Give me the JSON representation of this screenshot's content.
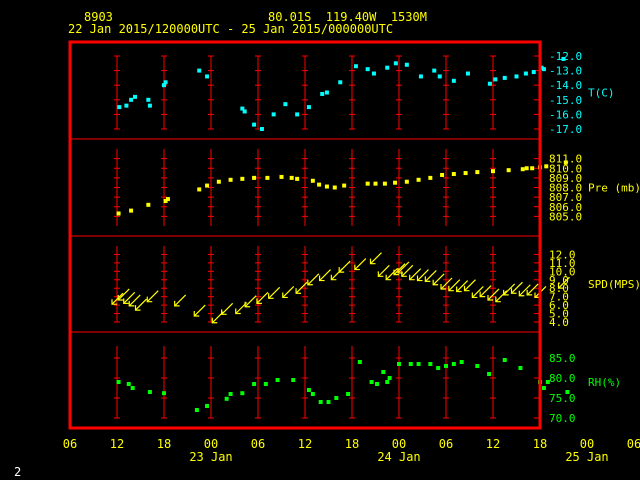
{
  "header": {
    "station_id": "8903",
    "location": "80.01S  119.40W  1530M",
    "time_range": "22 Jan 2015/120000UTC - 25 Jan 2015/000000UTC"
  },
  "page_number": "2",
  "colors": {
    "background": "#000000",
    "frame": "#ff0000",
    "grid": "#ff0000",
    "header_text": "#ffff00",
    "temperature": "#00ffff",
    "pressure": "#ffff00",
    "wind": "#ffff00",
    "humidity": "#00ff00"
  },
  "chart_data": {
    "type": "scatter",
    "grid": true,
    "x_axis": {
      "unit": "UTC hour",
      "range_hours": [
        -6,
        54
      ],
      "tick_labels": [
        "06",
        "12",
        "18",
        "00",
        "06",
        "12",
        "18",
        "00",
        "06",
        "12",
        "18",
        "00",
        "06"
      ],
      "tick_hours": [
        -6,
        0,
        6,
        12,
        18,
        24,
        30,
        36,
        42,
        48,
        54,
        60,
        66
      ],
      "day_labels": [
        {
          "label": "23 Jan",
          "hour": 12
        },
        {
          "label": "24 Jan",
          "hour": 36
        },
        {
          "label": "25 Jan",
          "hour": 60
        }
      ]
    },
    "panels": [
      {
        "key": "temperature",
        "label": "T(C)",
        "mark": "square",
        "ylim": [
          -17,
          -12
        ],
        "ticks": [
          -12.0,
          -13.0,
          -14.0,
          -15.0,
          -16.0,
          -17.0
        ],
        "tick_labels": [
          "-12.0",
          "-13.0",
          "-14.0",
          "-15.0",
          "-16.0",
          "-17.0"
        ],
        "points": [
          [
            0.3,
            -15.5
          ],
          [
            1.2,
            -15.4
          ],
          [
            1.8,
            -15.0
          ],
          [
            2.3,
            -14.8
          ],
          [
            4.0,
            -15.0
          ],
          [
            4.2,
            -15.4
          ],
          [
            6.0,
            -14.0
          ],
          [
            6.2,
            -13.8
          ],
          [
            10.5,
            -13.0
          ],
          [
            11.5,
            -13.4
          ],
          [
            16.0,
            -15.6
          ],
          [
            16.3,
            -15.8
          ],
          [
            17.5,
            -16.7
          ],
          [
            18.5,
            -17.0
          ],
          [
            20.0,
            -16.0
          ],
          [
            21.5,
            -15.3
          ],
          [
            23.0,
            -16.0
          ],
          [
            24.5,
            -15.5
          ],
          [
            26.2,
            -14.6
          ],
          [
            26.8,
            -14.5
          ],
          [
            28.5,
            -13.8
          ],
          [
            30.5,
            -12.7
          ],
          [
            32.0,
            -12.9
          ],
          [
            32.8,
            -13.2
          ],
          [
            34.5,
            -12.8
          ],
          [
            35.6,
            -12.5
          ],
          [
            37.0,
            -12.6
          ],
          [
            38.8,
            -13.4
          ],
          [
            40.5,
            -13.0
          ],
          [
            41.2,
            -13.4
          ],
          [
            43.0,
            -13.7
          ],
          [
            44.8,
            -13.2
          ],
          [
            47.6,
            -13.9
          ],
          [
            48.3,
            -13.6
          ],
          [
            49.5,
            -13.5
          ],
          [
            51.0,
            -13.4
          ],
          [
            52.2,
            -13.2
          ],
          [
            53.2,
            -13.1
          ],
          [
            54.2,
            -12.8
          ],
          [
            54.5,
            -12.9
          ],
          [
            57.0,
            -12.2
          ]
        ]
      },
      {
        "key": "pressure",
        "label": "Pre (mb)",
        "mark": "square",
        "ylim": [
          804,
          812
        ],
        "ticks": [
          805.0,
          806.0,
          807.0,
          808.0,
          809.0,
          810.0,
          811.0
        ],
        "tick_labels": [
          "805.0",
          "806.0",
          "807.0",
          "808.0",
          "809.0",
          "810.0",
          "811.0"
        ],
        "points": [
          [
            0.2,
            805.3
          ],
          [
            1.8,
            805.6
          ],
          [
            4.0,
            806.2
          ],
          [
            6.2,
            806.6
          ],
          [
            6.5,
            806.8
          ],
          [
            10.5,
            807.8
          ],
          [
            11.5,
            808.2
          ],
          [
            13.0,
            808.6
          ],
          [
            14.5,
            808.8
          ],
          [
            16.0,
            808.9
          ],
          [
            17.5,
            809.0
          ],
          [
            19.2,
            809.0
          ],
          [
            21.0,
            809.1
          ],
          [
            22.3,
            809.0
          ],
          [
            23.0,
            808.9
          ],
          [
            25.0,
            808.7
          ],
          [
            25.8,
            808.3
          ],
          [
            26.8,
            808.1
          ],
          [
            27.8,
            808.0
          ],
          [
            29.0,
            808.2
          ],
          [
            32.0,
            808.4
          ],
          [
            33.0,
            808.4
          ],
          [
            34.2,
            808.4
          ],
          [
            35.5,
            808.5
          ],
          [
            37.0,
            808.6
          ],
          [
            38.5,
            808.8
          ],
          [
            40.0,
            809.0
          ],
          [
            41.5,
            809.3
          ],
          [
            43.0,
            809.4
          ],
          [
            44.5,
            809.5
          ],
          [
            46.0,
            809.6
          ],
          [
            48.0,
            809.7
          ],
          [
            50.0,
            809.8
          ],
          [
            51.8,
            809.9
          ],
          [
            52.3,
            810.0
          ],
          [
            53.0,
            810.0
          ],
          [
            54.0,
            810.1
          ],
          [
            54.8,
            810.2
          ],
          [
            57.3,
            810.6
          ]
        ]
      },
      {
        "key": "wind",
        "label": "SPD(MPS)",
        "mark": "arrow",
        "ylim": [
          4,
          13
        ],
        "ticks": [
          4.0,
          5.0,
          6.0,
          7.0,
          8.0,
          9.0,
          10.0,
          11.0,
          12.0
        ],
        "tick_labels": [
          "4.0",
          "5.0",
          "6.0",
          "7.0",
          "8.0",
          "9.0",
          "10.0",
          "11.0",
          "12.0"
        ],
        "points": [
          [
            0.0,
            6.7
          ],
          [
            0.8,
            7.2
          ],
          [
            1.5,
            6.8
          ],
          [
            2.2,
            6.5
          ],
          [
            3.0,
            6.0
          ],
          [
            4.5,
            7.0
          ],
          [
            8.0,
            6.5
          ],
          [
            10.5,
            5.3
          ],
          [
            12.8,
            4.5
          ],
          [
            14.0,
            5.5
          ],
          [
            15.8,
            5.6
          ],
          [
            17.0,
            6.4
          ],
          [
            18.5,
            6.8
          ],
          [
            20.0,
            7.4
          ],
          [
            21.8,
            7.5
          ],
          [
            23.5,
            8.0
          ],
          [
            25.0,
            9.0
          ],
          [
            26.5,
            9.5
          ],
          [
            28.0,
            9.6
          ],
          [
            29.0,
            10.5
          ],
          [
            31.0,
            10.8
          ],
          [
            33.0,
            11.5
          ],
          [
            34.0,
            10.0
          ],
          [
            35.0,
            9.6
          ],
          [
            36.0,
            10.2
          ],
          [
            36.5,
            10.4
          ],
          [
            37.0,
            10.0
          ],
          [
            38.0,
            9.6
          ],
          [
            39.0,
            9.5
          ],
          [
            40.0,
            9.4
          ],
          [
            41.0,
            9.0
          ],
          [
            42.0,
            8.5
          ],
          [
            43.0,
            8.3
          ],
          [
            44.0,
            8.2
          ],
          [
            45.0,
            8.3
          ],
          [
            46.0,
            7.5
          ],
          [
            47.0,
            7.6
          ],
          [
            48.0,
            7.2
          ],
          [
            49.0,
            7.0
          ],
          [
            50.0,
            7.8
          ],
          [
            51.0,
            8.0
          ],
          [
            52.0,
            7.7
          ],
          [
            53.0,
            7.8
          ],
          [
            54.0,
            7.5
          ],
          [
            57.0,
            8.6
          ]
        ]
      },
      {
        "key": "humidity",
        "label": "RH(%)",
        "mark": "square",
        "ylim": [
          70,
          88
        ],
        "ticks": [
          70.0,
          75.0,
          80.0,
          85.0
        ],
        "tick_labels": [
          "70.0",
          "75.0",
          "80.0",
          "85.0"
        ],
        "points": [
          [
            0.2,
            79.0
          ],
          [
            1.5,
            78.5
          ],
          [
            2.0,
            77.5
          ],
          [
            4.2,
            76.5
          ],
          [
            6.0,
            76.2
          ],
          [
            10.2,
            72.0
          ],
          [
            11.5,
            73.0
          ],
          [
            14.0,
            74.8
          ],
          [
            14.5,
            76.0
          ],
          [
            16.0,
            76.2
          ],
          [
            17.5,
            78.5
          ],
          [
            19.0,
            78.5
          ],
          [
            20.5,
            79.5
          ],
          [
            22.5,
            79.5
          ],
          [
            24.5,
            77.0
          ],
          [
            25.0,
            76.0
          ],
          [
            26.0,
            74.0
          ],
          [
            27.0,
            74.0
          ],
          [
            28.0,
            75.0
          ],
          [
            29.5,
            76.0
          ],
          [
            31.0,
            84.0
          ],
          [
            32.5,
            79.0
          ],
          [
            33.2,
            78.5
          ],
          [
            34.0,
            81.5
          ],
          [
            34.5,
            79.0
          ],
          [
            34.8,
            80.0
          ],
          [
            36.0,
            83.5
          ],
          [
            37.5,
            83.5
          ],
          [
            38.5,
            83.5
          ],
          [
            40.0,
            83.5
          ],
          [
            41.0,
            82.5
          ],
          [
            42.0,
            83.0
          ],
          [
            43.0,
            83.5
          ],
          [
            44.0,
            84.0
          ],
          [
            46.0,
            83.0
          ],
          [
            47.5,
            81.0
          ],
          [
            49.5,
            84.5
          ],
          [
            51.5,
            82.5
          ],
          [
            54.0,
            79.0
          ],
          [
            54.5,
            77.5
          ],
          [
            55.0,
            79.0
          ],
          [
            57.5,
            76.5
          ]
        ]
      }
    ]
  }
}
